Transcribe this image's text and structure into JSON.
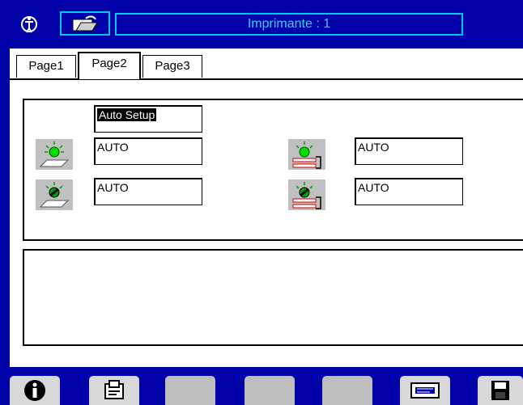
{
  "window": {
    "title": "Imprimante : 1"
  },
  "tabs": [
    {
      "label": "Page1",
      "active": false
    },
    {
      "label": "Page2",
      "active": true
    },
    {
      "label": "Page3",
      "active": false
    }
  ],
  "fields": {
    "auto_setup": "Auto Setup",
    "left_top": "AUTO",
    "left_bottom": "AUTO",
    "right_top": "AUTO",
    "right_bottom": "AUTO"
  },
  "toolbar": {
    "buttons": [
      "info-icon",
      "printer-settings-icon",
      "blank-button",
      "blank-button",
      "blank-button",
      "message-icon",
      "save-icon"
    ]
  },
  "colors": {
    "frame": "#0000a8",
    "title_text": "#37d0ff",
    "accent_border": "#00c8ff",
    "button": "#bdbdbd"
  }
}
